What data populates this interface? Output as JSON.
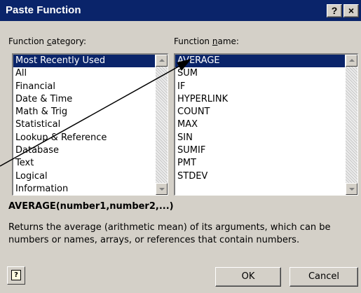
{
  "dialog": {
    "title": "Paste Function",
    "help_title_button": "?",
    "close_button": "×"
  },
  "category": {
    "label_before": "Function ",
    "label_key": "c",
    "label_after": "ategory:",
    "items": [
      {
        "label": "Most Recently Used",
        "selected": true
      },
      {
        "label": "All"
      },
      {
        "label": "Financial"
      },
      {
        "label": "Date & Time"
      },
      {
        "label": "Math & Trig"
      },
      {
        "label": "Statistical"
      },
      {
        "label": "Lookup & Reference"
      },
      {
        "label": "Database"
      },
      {
        "label": "Text"
      },
      {
        "label": "Logical"
      },
      {
        "label": "Information"
      }
    ]
  },
  "function": {
    "label_before": "Function ",
    "label_key": "n",
    "label_after": "ame:",
    "items": [
      {
        "label": "AVERAGE",
        "selected": true
      },
      {
        "label": "SUM"
      },
      {
        "label": "IF"
      },
      {
        "label": "HYPERLINK"
      },
      {
        "label": "COUNT"
      },
      {
        "label": "MAX"
      },
      {
        "label": "SIN"
      },
      {
        "label": "SUMIF"
      },
      {
        "label": "PMT"
      },
      {
        "label": "STDEV"
      }
    ]
  },
  "syntax": "AVERAGE(number1,number2,...)",
  "description": "Returns the average (arithmetic mean) of its arguments, which can be numbers or names, arrays, or references that contain numbers.",
  "buttons": {
    "ok": "OK",
    "cancel": "Cancel"
  },
  "icons": {
    "help_button": "help-question-icon",
    "scroll_up": "up-arrow-icon",
    "scroll_down": "down-arrow-icon",
    "annotation": "annotation-arrow"
  }
}
